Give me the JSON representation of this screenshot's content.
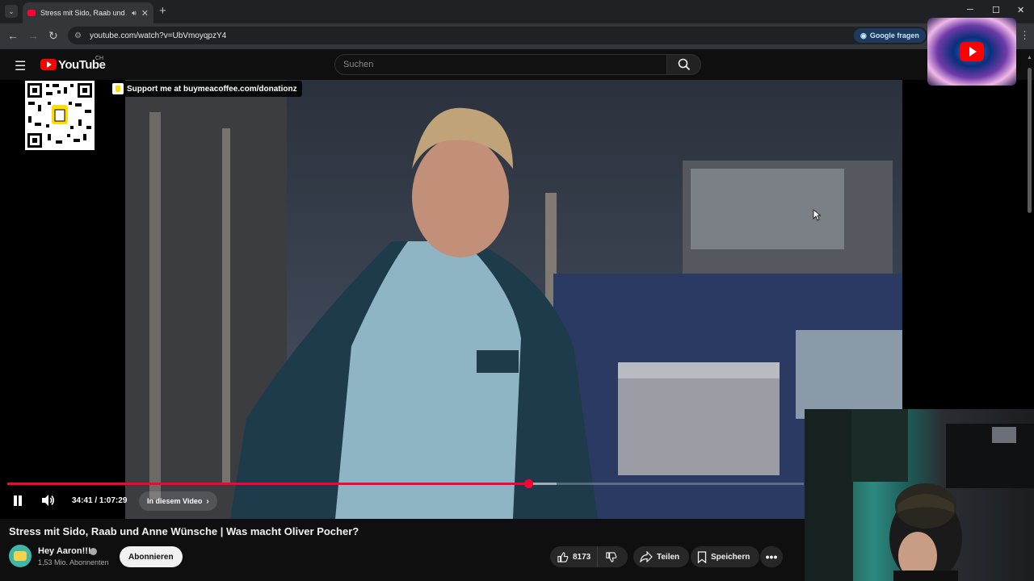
{
  "browser": {
    "tab_title": "Stress mit Sido, Raab und Anne",
    "tab_close": "✕",
    "new_tab": "+",
    "url": "youtube.com/watch?v=UbVmoyqpzY4",
    "google_ask": "Google fragen",
    "win_minimize": "─",
    "win_maximize": "☐",
    "win_close": "✕"
  },
  "youtube": {
    "logo_text": "YouTube",
    "country": "CH",
    "search_placeholder": "Suchen"
  },
  "overlay": {
    "donate_text": "Support me at buymeacoffee.com/donationz"
  },
  "player": {
    "time": "34:41 / 1:07:29",
    "chapter_label": "In diesem Video",
    "progress_fraction": 0.654,
    "buffer_fraction": 0.69,
    "state": "playing"
  },
  "video": {
    "title": "Stress mit Sido, Raab und Anne Wünsche | Was macht Oliver Pocher?",
    "channel_name": "Hey Aaron!!!",
    "subscribers": "1,53 Mio. Abonnenten",
    "subscribe_label": "Abonnieren",
    "likes": "8173",
    "share_label": "Teilen",
    "save_label": "Speichern",
    "more_label": "•••"
  },
  "colors": {
    "accent": "#ff0033",
    "background": "#0f0f0f"
  }
}
